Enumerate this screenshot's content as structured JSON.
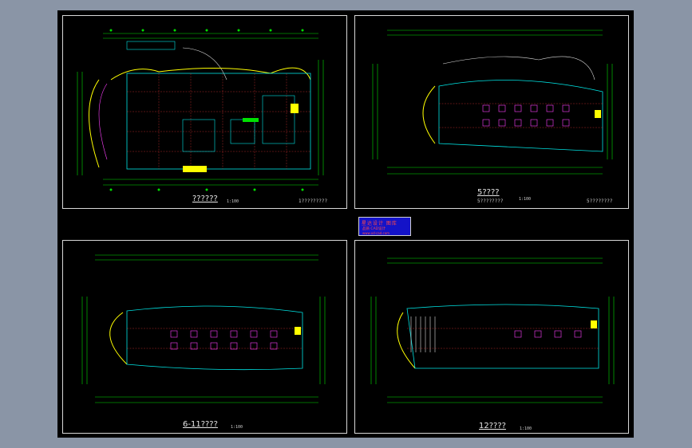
{
  "colors": {
    "background": "#8a95a6",
    "canvas": "#000000",
    "frame": "#d8d8d8",
    "axis": "#00e000",
    "wall": "#00e5e5",
    "grid": "#e03030",
    "partition": "#e0e0e0",
    "accent": "#ff40ff",
    "highlight": "#ffff00",
    "stamp": "#1413c8"
  },
  "sheets": [
    {
      "id": "ground-floor-plan",
      "title": "??????",
      "scale": "1:100",
      "note": "1?????????"
    },
    {
      "id": "fifth-floor-plan",
      "title": "5????",
      "subtitle": "5????????",
      "scale": "1:100",
      "note": "5????????"
    },
    {
      "id": "sixth-eleventh-floor-plan",
      "title": "6-11????",
      "scale": "1:100"
    },
    {
      "id": "twelfth-floor-plan",
      "title": "12????",
      "scale": "1:100"
    }
  ],
  "stamp": {
    "line1": "星达设计 图库",
    "line2": "品质 CAD设计",
    "line3": "www.xd-cad.com"
  }
}
